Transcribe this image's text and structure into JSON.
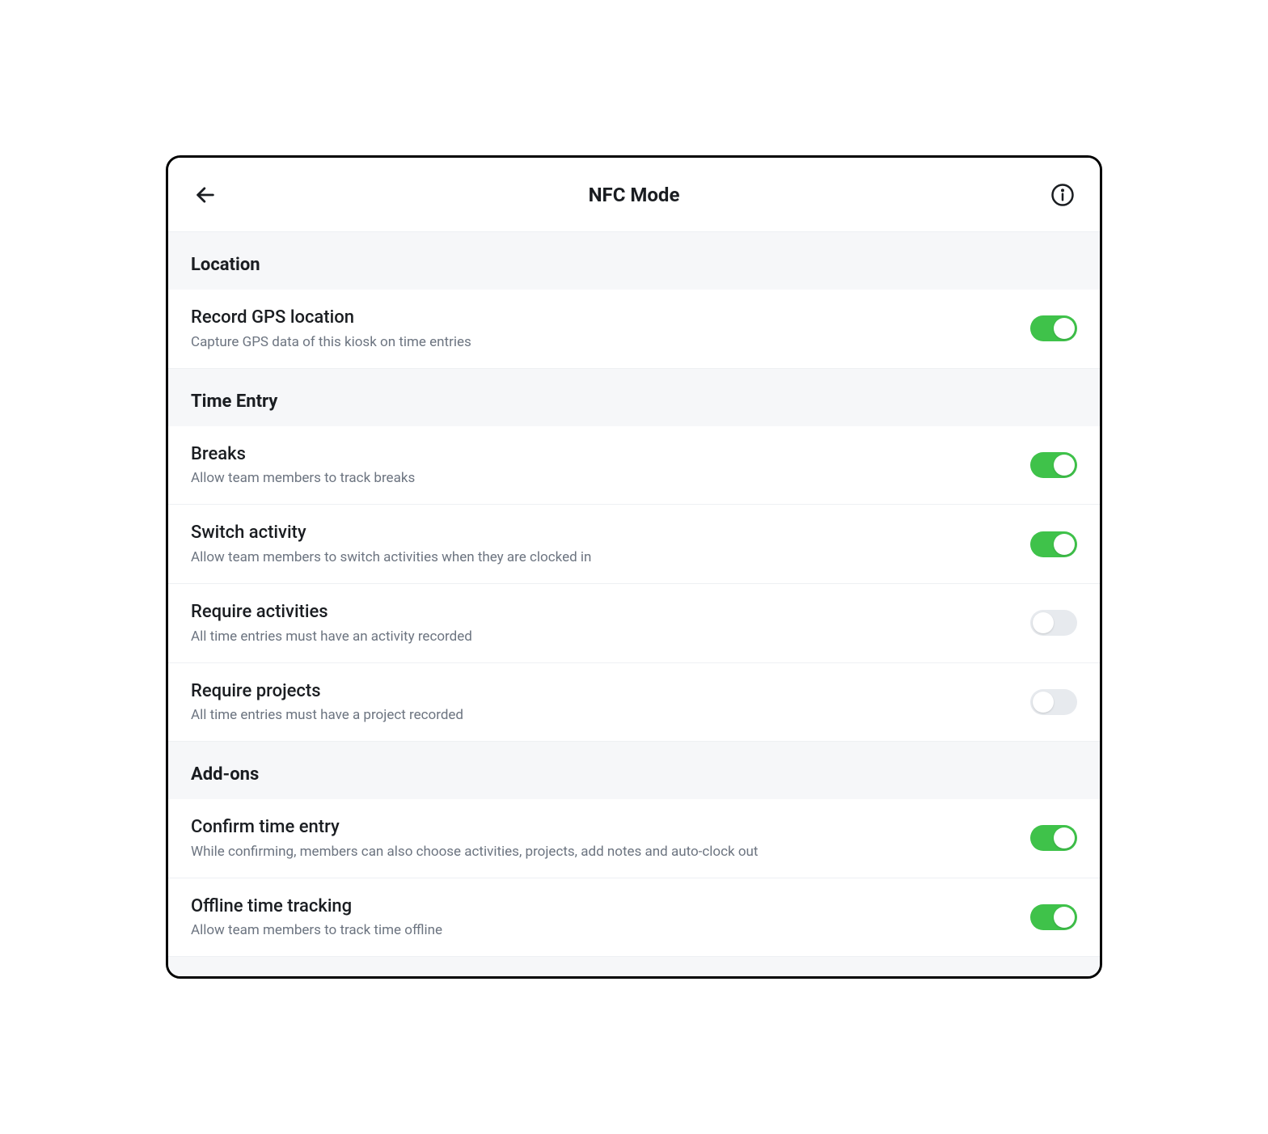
{
  "header": {
    "title": "NFC Mode"
  },
  "sections": {
    "location": {
      "heading": "Location",
      "gps": {
        "title": "Record GPS location",
        "sub": "Capture GPS data of this kiosk on time entries",
        "on": true
      }
    },
    "timeEntry": {
      "heading": "Time Entry",
      "breaks": {
        "title": "Breaks",
        "sub": "Allow team members to track breaks",
        "on": true
      },
      "switchActivity": {
        "title": "Switch activity",
        "sub": "Allow team members to switch activities when they are clocked in",
        "on": true
      },
      "requireActivities": {
        "title": "Require activities",
        "sub": "All time entries must have an activity recorded",
        "on": false
      },
      "requireProjects": {
        "title": "Require projects",
        "sub": "All time entries must have a project recorded",
        "on": false
      }
    },
    "addons": {
      "heading": "Add-ons",
      "confirmTimeEntry": {
        "title": "Confirm time entry",
        "sub": "While confirming, members can also choose activities, projects, add notes and auto-clock out",
        "on": true
      },
      "offlineTracking": {
        "title": "Offline time tracking",
        "sub": "Allow team members to track time offline",
        "on": true
      }
    }
  }
}
